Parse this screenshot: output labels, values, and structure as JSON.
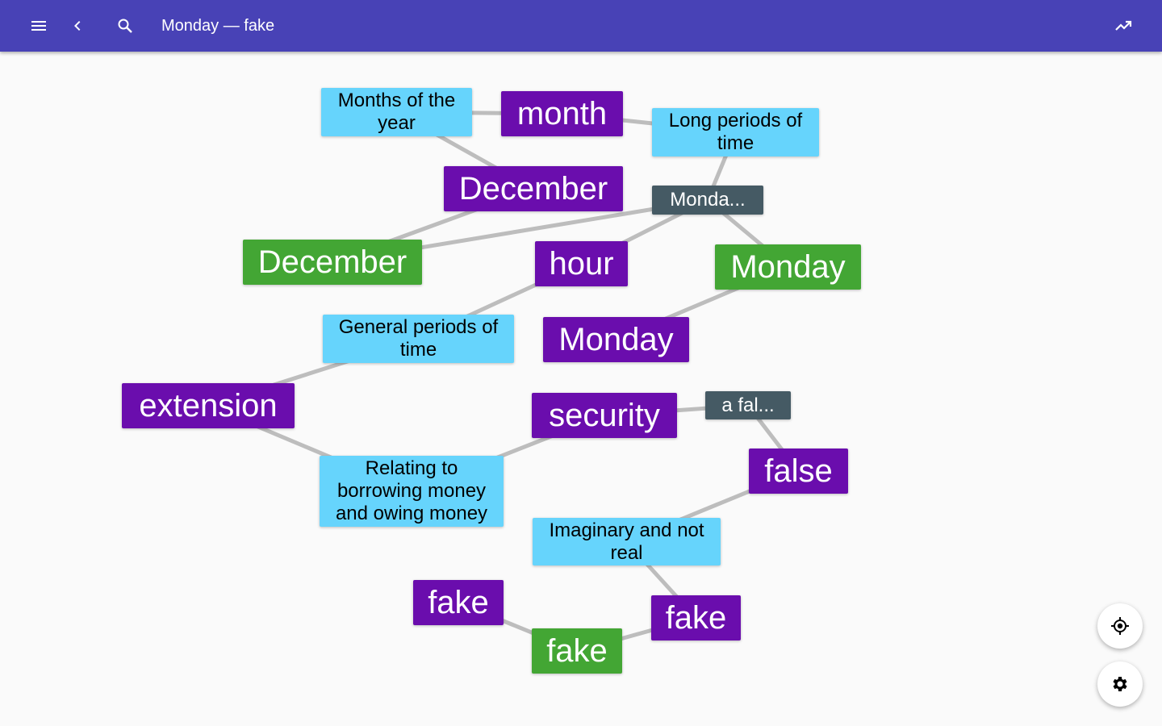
{
  "appbar": {
    "title": "Monday — fake",
    "icons": [
      "menu-icon",
      "chevron-left-icon",
      "search-icon",
      "trending-up-icon"
    ]
  },
  "graph": {
    "nodes": [
      {
        "id": "def-months",
        "type": "def",
        "label": "Months of the year"
      },
      {
        "id": "word-month",
        "type": "word",
        "label": "month"
      },
      {
        "id": "def-long",
        "type": "def",
        "label": "Long periods of time"
      },
      {
        "id": "word-december",
        "type": "word",
        "label": "December"
      },
      {
        "id": "syn-monday",
        "type": "syn",
        "label": "Monda..."
      },
      {
        "id": "root-december",
        "type": "root",
        "label": "December"
      },
      {
        "id": "word-hour",
        "type": "word",
        "label": "hour"
      },
      {
        "id": "root-monday",
        "type": "root",
        "label": "Monday"
      },
      {
        "id": "def-general",
        "type": "def",
        "label": "General periods of time"
      },
      {
        "id": "word-monday",
        "type": "word",
        "label": "Monday"
      },
      {
        "id": "word-extension",
        "type": "word",
        "label": "extension"
      },
      {
        "id": "word-security",
        "type": "word",
        "label": "security"
      },
      {
        "id": "syn-false",
        "type": "syn",
        "label": "a fal..."
      },
      {
        "id": "def-borrow",
        "type": "def",
        "label": "Relating to borrowing money and owing money"
      },
      {
        "id": "word-false",
        "type": "word",
        "label": "false"
      },
      {
        "id": "def-imaginary",
        "type": "def",
        "label": "Imaginary and not real"
      },
      {
        "id": "word-fake-a",
        "type": "word",
        "label": "fake"
      },
      {
        "id": "word-fake-b",
        "type": "word",
        "label": "fake"
      },
      {
        "id": "root-fake",
        "type": "root",
        "label": "fake"
      }
    ],
    "edges": [
      [
        "def-months",
        "word-month"
      ],
      [
        "word-month",
        "def-long"
      ],
      [
        "def-months",
        "word-december"
      ],
      [
        "def-long",
        "syn-monday"
      ],
      [
        "word-december",
        "root-december"
      ],
      [
        "root-december",
        "syn-monday"
      ],
      [
        "syn-monday",
        "word-hour"
      ],
      [
        "syn-monday",
        "root-monday"
      ],
      [
        "word-hour",
        "def-general"
      ],
      [
        "root-monday",
        "word-monday"
      ],
      [
        "def-general",
        "word-extension"
      ],
      [
        "word-extension",
        "def-borrow"
      ],
      [
        "def-borrow",
        "word-security"
      ],
      [
        "word-security",
        "syn-false"
      ],
      [
        "syn-false",
        "word-false"
      ],
      [
        "word-false",
        "def-imaginary"
      ],
      [
        "def-imaginary",
        "word-fake-b"
      ],
      [
        "word-fake-b",
        "root-fake"
      ],
      [
        "root-fake",
        "word-fake-a"
      ]
    ]
  },
  "fabs": {
    "locate_icon": "my-location-icon",
    "settings_icon": "settings-icon"
  },
  "colors": {
    "appbar": "#4842b6",
    "word": "#6a0dad",
    "root": "#43a634",
    "definition": "#66d4fc",
    "synonym": "#455a64",
    "edge": "#bdbdbd"
  }
}
